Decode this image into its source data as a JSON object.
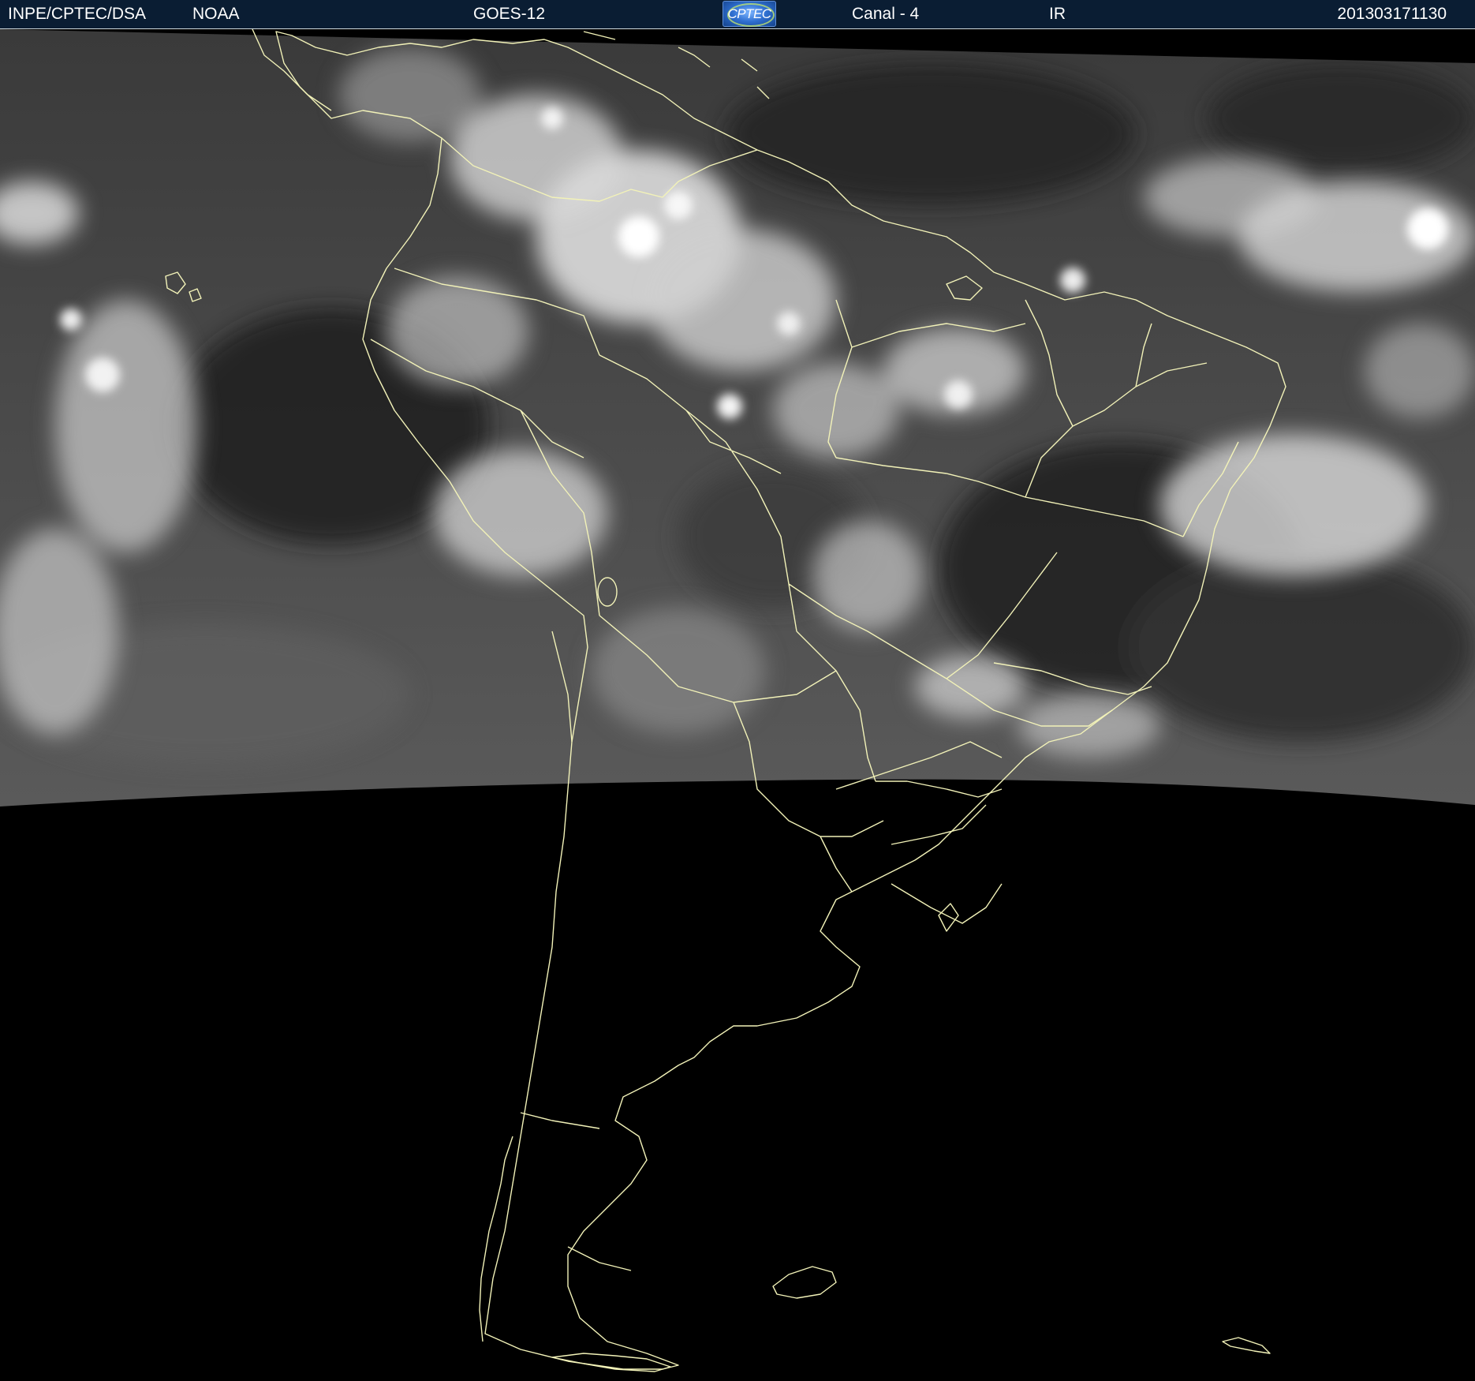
{
  "header": {
    "agency": "INPE/CPTEC/DSA",
    "source": "NOAA",
    "satellite": "GOES-12",
    "logo_text": "CPTEC",
    "channel": "Canal - 4",
    "band": "IR",
    "timestamp": "201303171130"
  },
  "colors": {
    "header_bg": "#0a1d33",
    "boundary_lines": "#f2f2b8",
    "space_bg": "#000000",
    "cloud_high": "#f4f4f4",
    "surface_low": "#2a2a2a"
  },
  "map": {
    "region": "South America",
    "imagery": "infrared cloud cover",
    "overlay": "political boundaries and coastlines"
  }
}
